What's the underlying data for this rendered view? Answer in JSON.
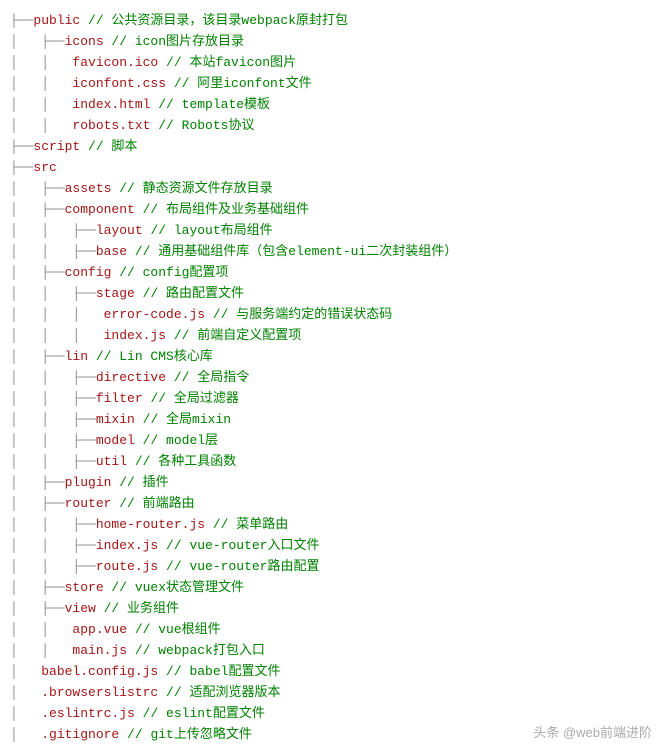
{
  "lines": [
    {
      "prefix": "├──",
      "name": "public",
      "comment": " // 公共资源目录，该目录webpack原封打包"
    },
    {
      "prefix": "│   ├──",
      "name": "icons",
      "comment": " // icon图片存放目录"
    },
    {
      "prefix": "│   │   ",
      "name": "favicon.ico",
      "comment": " // 本站favicon图片"
    },
    {
      "prefix": "│   │   ",
      "name": "iconfont.css",
      "comment": " // 阿里iconfont文件"
    },
    {
      "prefix": "│   │   ",
      "name": "index.html",
      "comment": " // template模板"
    },
    {
      "prefix": "│   │   ",
      "name": "robots.txt",
      "comment": " // Robots协议"
    },
    {
      "prefix": "├──",
      "name": "script",
      "comment": " // 脚本"
    },
    {
      "prefix": "├──",
      "name": "src",
      "comment": ""
    },
    {
      "prefix": "│   ├──",
      "name": "assets",
      "comment": " // 静态资源文件存放目录"
    },
    {
      "prefix": "│   ├──",
      "name": "component",
      "comment": " // 布局组件及业务基础组件"
    },
    {
      "prefix": "│   │   ├──",
      "name": "layout",
      "comment": " // layout布局组件"
    },
    {
      "prefix": "│   │   ├──",
      "name": "base",
      "comment": " // 通用基础组件库（包含element-ui二次封装组件）"
    },
    {
      "prefix": "│   ├──",
      "name": "config",
      "comment": " // config配置项"
    },
    {
      "prefix": "│   │   ├──",
      "name": "stage",
      "comment": " // 路由配置文件"
    },
    {
      "prefix": "│   │   │   ",
      "name": "error-code.js",
      "comment": " // 与服务端约定的错误状态码"
    },
    {
      "prefix": "│   │   │   ",
      "name": "index.js",
      "comment": " // 前端自定义配置项"
    },
    {
      "prefix": "│   ├──",
      "name": "lin",
      "comment": " // Lin CMS核心库"
    },
    {
      "prefix": "│   │   ├──",
      "name": "directive",
      "comment": " // 全局指令"
    },
    {
      "prefix": "│   │   ├──",
      "name": "filter",
      "comment": " // 全局过滤器"
    },
    {
      "prefix": "│   │   ├──",
      "name": "mixin",
      "comment": " // 全局mixin"
    },
    {
      "prefix": "│   │   ├──",
      "name": "model",
      "comment": " // model层"
    },
    {
      "prefix": "│   │   ├──",
      "name": "util",
      "comment": " // 各种工具函数"
    },
    {
      "prefix": "│   ├──",
      "name": "plugin",
      "comment": " // 插件"
    },
    {
      "prefix": "│   ├──",
      "name": "router",
      "comment": " // 前端路由"
    },
    {
      "prefix": "│   │   ├──",
      "name": "home-router.js",
      "comment": " // 菜单路由"
    },
    {
      "prefix": "│   │   ├──",
      "name": "index.js",
      "comment": " // vue-router入口文件"
    },
    {
      "prefix": "│   │   ├──",
      "name": "route.js",
      "comment": " // vue-router路由配置"
    },
    {
      "prefix": "│   ├──",
      "name": "store",
      "comment": " // vuex状态管理文件"
    },
    {
      "prefix": "│   ├──",
      "name": "view",
      "comment": " // 业务组件"
    },
    {
      "prefix": "│   │   ",
      "name": "app.vue",
      "comment": " // vue根组件"
    },
    {
      "prefix": "│   │   ",
      "name": "main.js",
      "comment": " // webpack打包入口"
    },
    {
      "prefix": "│   ",
      "name": "babel.config.js",
      "comment": " // babel配置文件"
    },
    {
      "prefix": "│   ",
      "name": ".browserslistrc",
      "comment": " // 适配浏览器版本"
    },
    {
      "prefix": "│   ",
      "name": ".eslintrc.js",
      "comment": " // eslint配置文件"
    },
    {
      "prefix": "│   ",
      "name": ".gitignore",
      "comment": " // git上传忽略文件"
    }
  ],
  "watermark": "头条 @web前端进阶"
}
